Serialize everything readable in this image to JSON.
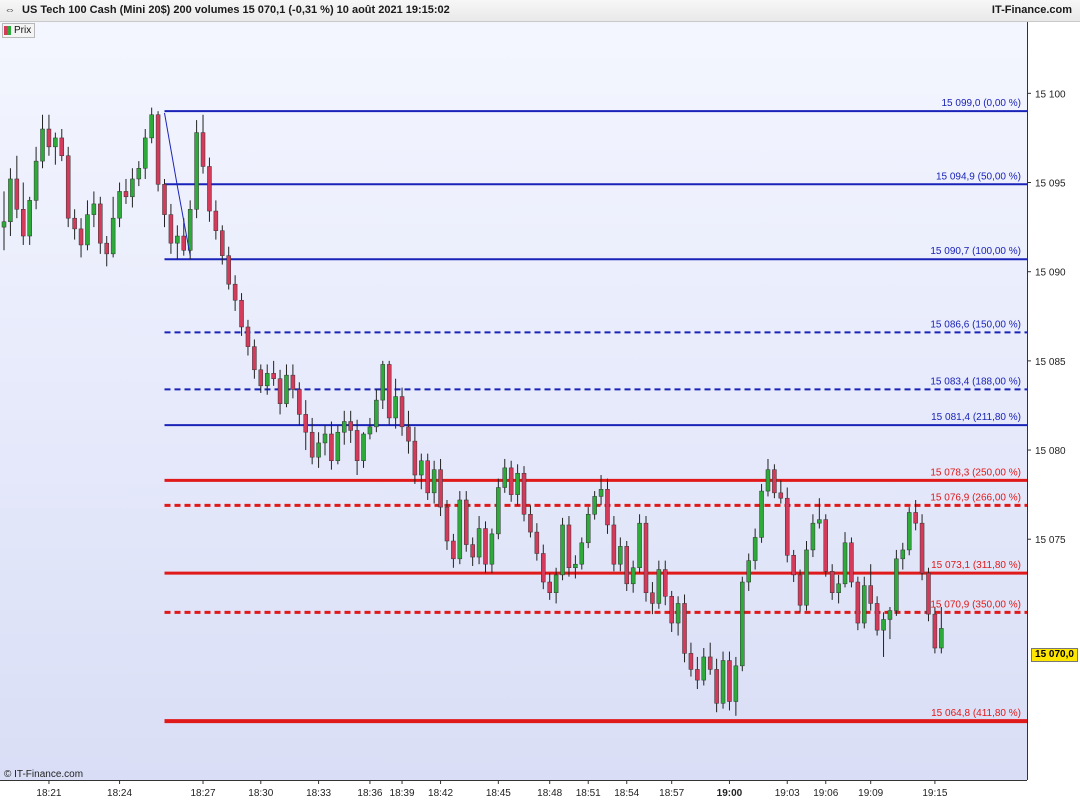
{
  "header": {
    "title": "US Tech 100 Cash (Mini 20$) 200 volumes 15 070,1 (-0,31 %) 10 août 2021 19:15:02",
    "brand": "IT-Finance.com",
    "icon": "arrow-left-right-icon"
  },
  "legend": {
    "label": "Prix"
  },
  "footer": {
    "copyright": "© IT-Finance.com"
  },
  "colors": {
    "background_top": "#f4f6ff",
    "background_bottom": "#d9def6",
    "bull": "#2eaa3a",
    "bear": "#d43a5a",
    "fib_blue": "#1a23b8",
    "fib_red": "#e01a1a",
    "last_price_bg": "#ffe600"
  },
  "chart_data": {
    "type": "candlestick",
    "title": "US Tech 100 Cash (Mini 20$) 200 volumes",
    "last_price": "15 070,0",
    "ylim": [
      15061.5,
      15104.0
    ],
    "y_ticks": [
      {
        "value": 15100,
        "label": "15 100"
      },
      {
        "value": 15095,
        "label": "15 095"
      },
      {
        "value": 15090,
        "label": "15 090"
      },
      {
        "value": 15085,
        "label": "15 085"
      },
      {
        "value": 15080,
        "label": "15 080"
      },
      {
        "value": 15075,
        "label": "15 075"
      }
    ],
    "x_ticks": [
      {
        "index": 7,
        "label": "18:21"
      },
      {
        "index": 18,
        "label": "18:24"
      },
      {
        "index": 31,
        "label": "18:27"
      },
      {
        "index": 40,
        "label": "18:30"
      },
      {
        "index": 49,
        "label": "18:33"
      },
      {
        "index": 57,
        "label": "18:36"
      },
      {
        "index": 62,
        "label": "18:39"
      },
      {
        "index": 68,
        "label": "18:42"
      },
      {
        "index": 77,
        "label": "18:45"
      },
      {
        "index": 85,
        "label": "18:48"
      },
      {
        "index": 91,
        "label": "18:51"
      },
      {
        "index": 97,
        "label": "18:54"
      },
      {
        "index": 104,
        "label": "18:57"
      },
      {
        "index": 113,
        "label": "19:00",
        "bold": true
      },
      {
        "index": 122,
        "label": "19:03"
      },
      {
        "index": 128,
        "label": "19:06"
      },
      {
        "index": 135,
        "label": "19:09"
      },
      {
        "index": 145,
        "label": "19:15"
      }
    ],
    "candles": [
      [
        15092.5,
        15094.5,
        15091.2,
        15092.8
      ],
      [
        15092.8,
        15095.8,
        15092.0,
        15095.2
      ],
      [
        15095.2,
        15096.5,
        15093.0,
        15093.5
      ],
      [
        15093.5,
        15095.0,
        15091.5,
        15092.0
      ],
      [
        15092.0,
        15094.2,
        15091.5,
        15094.0
      ],
      [
        15094.0,
        15097.0,
        15093.5,
        15096.2
      ],
      [
        15096.2,
        15098.8,
        15095.8,
        15098.0
      ],
      [
        15098.0,
        15098.8,
        15096.5,
        15097.0
      ],
      [
        15097.0,
        15097.8,
        15096.0,
        15097.5
      ],
      [
        15097.5,
        15098.0,
        15096.2,
        15096.5
      ],
      [
        15096.5,
        15097.0,
        15092.5,
        15093.0
      ],
      [
        15093.0,
        15093.5,
        15091.8,
        15092.4
      ],
      [
        15092.4,
        15093.0,
        15090.8,
        15091.5
      ],
      [
        15091.5,
        15094.0,
        15091.2,
        15093.2
      ],
      [
        15093.2,
        15094.5,
        15092.5,
        15093.8
      ],
      [
        15093.8,
        15094.2,
        15091.0,
        15091.6
      ],
      [
        15091.6,
        15092.0,
        15090.3,
        15091.0
      ],
      [
        15091.0,
        15094.2,
        15090.8,
        15093.0
      ],
      [
        15093.0,
        15095.0,
        15092.5,
        15094.5
      ],
      [
        15094.5,
        15095.2,
        15093.8,
        15094.2
      ],
      [
        15094.2,
        15095.8,
        15093.6,
        15095.2
      ],
      [
        15095.2,
        15096.2,
        15094.8,
        15095.8
      ],
      [
        15095.8,
        15098.0,
        15095.2,
        15097.5
      ],
      [
        15097.5,
        15099.2,
        15097.2,
        15098.8
      ],
      [
        15098.8,
        15099.0,
        15094.5,
        15094.9
      ],
      [
        15094.9,
        15095.2,
        15092.5,
        15093.2
      ],
      [
        15093.2,
        15093.8,
        15091.0,
        15091.6
      ],
      [
        15091.6,
        15092.6,
        15090.7,
        15092.0
      ],
      [
        15092.0,
        15093.0,
        15090.9,
        15091.2
      ],
      [
        15091.2,
        15094.0,
        15090.7,
        15093.5
      ],
      [
        15093.5,
        15098.5,
        15093.0,
        15097.8
      ],
      [
        15097.8,
        15098.8,
        15095.5,
        15095.9
      ],
      [
        15095.9,
        15096.4,
        15092.8,
        15093.4
      ],
      [
        15093.4,
        15094.0,
        15091.8,
        15092.3
      ],
      [
        15092.3,
        15092.6,
        15090.4,
        15090.9
      ],
      [
        15090.9,
        15091.4,
        15089.0,
        15089.3
      ],
      [
        15089.3,
        15089.8,
        15087.8,
        15088.4
      ],
      [
        15088.4,
        15088.8,
        15086.4,
        15086.9
      ],
      [
        15086.9,
        15087.3,
        15085.3,
        15085.8
      ],
      [
        15085.8,
        15086.2,
        15084.0,
        15084.5
      ],
      [
        15084.5,
        15084.8,
        15083.2,
        15083.6
      ],
      [
        15083.6,
        15084.8,
        15083.1,
        15084.3
      ],
      [
        15084.3,
        15085.0,
        15083.6,
        15084.0
      ],
      [
        15084.0,
        15084.5,
        15082.0,
        15082.6
      ],
      [
        15082.6,
        15084.8,
        15082.4,
        15084.2
      ],
      [
        15084.2,
        15084.8,
        15082.9,
        15083.4
      ],
      [
        15083.4,
        15083.8,
        15081.4,
        15082.0
      ],
      [
        15082.0,
        15082.8,
        15080.0,
        15081.0
      ],
      [
        15081.0,
        15081.8,
        15079.2,
        15079.6
      ],
      [
        15079.6,
        15081.0,
        15079.0,
        15080.4
      ],
      [
        15080.4,
        15081.4,
        15079.7,
        15080.9
      ],
      [
        15080.9,
        15081.6,
        15078.9,
        15079.4
      ],
      [
        15079.4,
        15081.4,
        15079.2,
        15081.0
      ],
      [
        15081.0,
        15082.2,
        15080.3,
        15081.6
      ],
      [
        15081.6,
        15082.2,
        15080.4,
        15081.1
      ],
      [
        15081.1,
        15081.7,
        15078.6,
        15079.4
      ],
      [
        15079.4,
        15081.0,
        15079.0,
        15080.9
      ],
      [
        15080.9,
        15081.8,
        15080.6,
        15081.3
      ],
      [
        15081.3,
        15083.4,
        15081.0,
        15082.8
      ],
      [
        15082.8,
        15085.0,
        15082.3,
        15084.8
      ],
      [
        15084.8,
        15085.0,
        15081.4,
        15081.8
      ],
      [
        15081.8,
        15084.0,
        15081.2,
        15083.0
      ],
      [
        15083.0,
        15083.5,
        15080.8,
        15081.3
      ],
      [
        15081.3,
        15082.2,
        15079.8,
        15080.5
      ],
      [
        15080.5,
        15081.3,
        15078.1,
        15078.6
      ],
      [
        15078.6,
        15079.8,
        15077.8,
        15079.4
      ],
      [
        15079.4,
        15079.8,
        15077.2,
        15077.6
      ],
      [
        15077.6,
        15079.4,
        15077.0,
        15078.9
      ],
      [
        15078.9,
        15079.5,
        15076.3,
        15076.8
      ],
      [
        15076.8,
        15077.2,
        15074.4,
        15074.9
      ],
      [
        15074.9,
        15075.3,
        15073.4,
        15073.9
      ],
      [
        15073.9,
        15077.7,
        15073.6,
        15077.2
      ],
      [
        15077.2,
        15077.7,
        15074.3,
        15074.7
      ],
      [
        15074.7,
        15075.1,
        15073.5,
        15074.0
      ],
      [
        15074.0,
        15076.3,
        15073.6,
        15075.6
      ],
      [
        15075.6,
        15076.0,
        15073.1,
        15073.6
      ],
      [
        15073.6,
        15075.6,
        15073.1,
        15075.3
      ],
      [
        15075.3,
        15078.4,
        15075.0,
        15077.9
      ],
      [
        15077.9,
        15079.5,
        15077.6,
        15079.0
      ],
      [
        15079.0,
        15079.4,
        15077.1,
        15077.5
      ],
      [
        15077.5,
        15079.2,
        15076.9,
        15078.7
      ],
      [
        15078.7,
        15079.1,
        15076.0,
        15076.4
      ],
      [
        15076.4,
        15076.9,
        15075.1,
        15075.4
      ],
      [
        15075.4,
        15075.9,
        15073.8,
        15074.2
      ],
      [
        15074.2,
        15074.7,
        15072.2,
        15072.6
      ],
      [
        15072.6,
        15073.1,
        15071.6,
        15072.0
      ],
      [
        15072.0,
        15073.4,
        15071.4,
        15073.0
      ],
      [
        15073.0,
        15076.2,
        15072.7,
        15075.8
      ],
      [
        15075.8,
        15076.3,
        15072.9,
        15073.4
      ],
      [
        15073.4,
        15074.1,
        15072.8,
        15073.6
      ],
      [
        15073.6,
        15075.1,
        15073.3,
        15074.8
      ],
      [
        15074.8,
        15076.8,
        15074.5,
        15076.4
      ],
      [
        15076.4,
        15077.7,
        15076.1,
        15077.4
      ],
      [
        15077.4,
        15078.6,
        15076.9,
        15077.8
      ],
      [
        15077.8,
        15078.4,
        15075.3,
        15075.8
      ],
      [
        15075.8,
        15076.3,
        15073.2,
        15073.6
      ],
      [
        15073.6,
        15075.1,
        15073.2,
        15074.6
      ],
      [
        15074.6,
        15074.9,
        15072.1,
        15072.5
      ],
      [
        15072.5,
        15073.8,
        15072.0,
        15073.4
      ],
      [
        15073.4,
        15076.4,
        15073.1,
        15075.9
      ],
      [
        15075.9,
        15076.3,
        15071.5,
        15072.0
      ],
      [
        15072.0,
        15072.6,
        15070.8,
        15071.4
      ],
      [
        15071.4,
        15073.8,
        15071.1,
        15073.3
      ],
      [
        15073.3,
        15073.8,
        15071.3,
        15071.8
      ],
      [
        15071.8,
        15072.1,
        15069.8,
        15070.3
      ],
      [
        15070.3,
        15071.8,
        15069.6,
        15071.4
      ],
      [
        15071.4,
        15071.9,
        15068.1,
        15068.6
      ],
      [
        15068.6,
        15069.2,
        15067.3,
        15067.7
      ],
      [
        15067.7,
        15068.4,
        15066.6,
        15067.1
      ],
      [
        15067.1,
        15068.9,
        15066.8,
        15068.4
      ],
      [
        15068.4,
        15069.2,
        15067.4,
        15067.7
      ],
      [
        15067.7,
        15068.3,
        15065.3,
        15065.8
      ],
      [
        15065.8,
        15068.7,
        15065.5,
        15068.2
      ],
      [
        15068.2,
        15068.7,
        15065.4,
        15065.9
      ],
      [
        15065.9,
        15068.4,
        15065.1,
        15067.9
      ],
      [
        15067.9,
        15072.9,
        15067.6,
        15072.6
      ],
      [
        15072.6,
        15074.2,
        15072.1,
        15073.8
      ],
      [
        15073.8,
        15075.6,
        15073.3,
        15075.1
      ],
      [
        15075.1,
        15078.1,
        15074.8,
        15077.7
      ],
      [
        15077.7,
        15079.5,
        15077.4,
        15078.9
      ],
      [
        15078.9,
        15079.2,
        15077.3,
        15077.6
      ],
      [
        15077.6,
        15078.3,
        15077.0,
        15077.3
      ],
      [
        15077.3,
        15077.9,
        15073.7,
        15074.1
      ],
      [
        15074.1,
        15074.4,
        15072.6,
        15073.0
      ],
      [
        15073.0,
        15073.3,
        15070.9,
        15071.3
      ],
      [
        15071.3,
        15074.9,
        15071.0,
        15074.4
      ],
      [
        15074.4,
        15076.4,
        15074.0,
        15075.9
      ],
      [
        15075.9,
        15077.3,
        15075.6,
        15076.1
      ],
      [
        15076.1,
        15076.4,
        15072.9,
        15073.2
      ],
      [
        15073.2,
        15073.6,
        15071.6,
        15072.0
      ],
      [
        15072.0,
        15073.0,
        15071.4,
        15072.5
      ],
      [
        15072.5,
        15075.4,
        15072.3,
        15074.8
      ],
      [
        15074.8,
        15075.1,
        15072.3,
        15072.6
      ],
      [
        15072.6,
        15072.9,
        15069.9,
        15070.3
      ],
      [
        15070.3,
        15072.9,
        15070.0,
        15072.4
      ],
      [
        15072.4,
        15073.6,
        15071.0,
        15071.4
      ],
      [
        15071.4,
        15071.8,
        15069.6,
        15069.9
      ],
      [
        15069.9,
        15070.9,
        15068.4,
        15070.5
      ],
      [
        15070.5,
        15071.2,
        15069.4,
        15071.0
      ],
      [
        15071.0,
        15074.4,
        15070.7,
        15073.9
      ],
      [
        15073.9,
        15074.8,
        15073.3,
        15074.4
      ],
      [
        15074.4,
        15076.8,
        15074.1,
        15076.5
      ],
      [
        15076.5,
        15077.2,
        15075.5,
        15075.9
      ],
      [
        15075.9,
        15076.4,
        15072.7,
        15073.1
      ],
      [
        15073.1,
        15073.4,
        15070.4,
        15070.8
      ],
      [
        15070.8,
        15071.2,
        15068.6,
        15068.9
      ],
      [
        15068.9,
        15071.2,
        15068.6,
        15070.0
      ]
    ],
    "trend_segment": [
      [
        25,
        15098.9
      ],
      [
        27,
        15094.8
      ],
      [
        29,
        15090.9
      ]
    ],
    "fib_levels": [
      {
        "value": 15099.0,
        "label": "15 099,0 (0,00 %)",
        "color": "#1a23b8",
        "style": "solid",
        "width": 2
      },
      {
        "value": 15094.9,
        "label": "15 094,9 (50,00 %)",
        "color": "#1a23b8",
        "style": "solid",
        "width": 2
      },
      {
        "value": 15090.7,
        "label": "15 090,7 (100,00 %)",
        "color": "#1a23b8",
        "style": "solid",
        "width": 2
      },
      {
        "value": 15086.6,
        "label": "15 086,6 (150,00 %)",
        "color": "#1a23b8",
        "style": "dashed",
        "width": 2
      },
      {
        "value": 15083.4,
        "label": "15 083,4 (188,00 %)",
        "color": "#1a23b8",
        "style": "dashed",
        "width": 2
      },
      {
        "value": 15081.4,
        "label": "15 081,4 (211,80 %)",
        "color": "#1a23b8",
        "style": "solid",
        "width": 2
      },
      {
        "value": 15078.3,
        "label": "15 078,3 (250,00 %)",
        "color": "#e01a1a",
        "style": "solid",
        "width": 3
      },
      {
        "value": 15076.9,
        "label": "15 076,9 (266,00 %)",
        "color": "#e01a1a",
        "style": "dashed",
        "width": 3
      },
      {
        "value": 15073.1,
        "label": "15 073,1 (311,80 %)",
        "color": "#e01a1a",
        "style": "solid",
        "width": 3
      },
      {
        "value": 15070.9,
        "label": "15 070,9 (350,00 %)",
        "color": "#e01a1a",
        "style": "dashed",
        "width": 3
      },
      {
        "value": 15064.8,
        "label": "15 064,8 (411,80 %)",
        "color": "#e01a1a",
        "style": "solid",
        "width": 4
      }
    ]
  }
}
